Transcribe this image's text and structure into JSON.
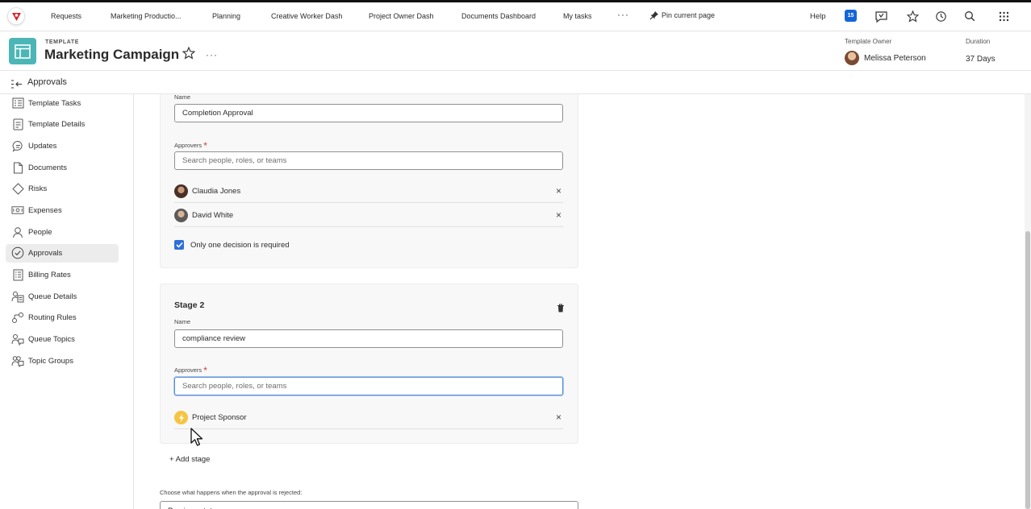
{
  "topnav": {
    "items": [
      "Requests",
      "Marketing Productio...",
      "Planning",
      "Creative Worker Dash",
      "Project Owner Dash",
      "Documents Dashboard",
      "My tasks"
    ],
    "more": "···",
    "pin_label": "Pin current page",
    "help": "Help",
    "notifications_count": "15"
  },
  "header": {
    "label": "TEMPLATE",
    "title": "Marketing Campaign",
    "more": "···",
    "owner_label": "Template Owner",
    "owner_name": "Melissa Peterson",
    "duration_label": "Duration",
    "duration_value": "37 Days",
    "accent_color": "#4cb6b6"
  },
  "subbar": {
    "title": "Approvals"
  },
  "sidebar": {
    "items": [
      {
        "label": "Template Tasks",
        "icon": "task-list-icon"
      },
      {
        "label": "Template Details",
        "icon": "details-icon"
      },
      {
        "label": "Updates",
        "icon": "chat-bubble-icon"
      },
      {
        "label": "Documents",
        "icon": "document-icon"
      },
      {
        "label": "Risks",
        "icon": "diamond-alert-icon"
      },
      {
        "label": "Expenses",
        "icon": "money-icon"
      },
      {
        "label": "People",
        "icon": "person-icon"
      },
      {
        "label": "Approvals",
        "icon": "check-circle-icon",
        "active": true
      },
      {
        "label": "Billing Rates",
        "icon": "billing-icon"
      },
      {
        "label": "Queue Details",
        "icon": "queue-icon"
      },
      {
        "label": "Routing Rules",
        "icon": "routing-icon"
      },
      {
        "label": "Queue Topics",
        "icon": "queue-topics-icon"
      },
      {
        "label": "Topic Groups",
        "icon": "topic-groups-icon"
      }
    ]
  },
  "stage1": {
    "name_label": "Name",
    "name_value": "Completion Approval",
    "approvers_label": "Approvers",
    "required_mark": "*",
    "search_placeholder": "Search people, roles, or teams",
    "approvers": [
      {
        "name": "Claudia Jones"
      },
      {
        "name": "David White"
      }
    ],
    "remove": "×",
    "one_decision_label": "Only one decision is required",
    "one_decision_checked": true
  },
  "stage2": {
    "title": "Stage 2",
    "name_label": "Name",
    "name_value": "compliance review",
    "approvers_label": "Approvers",
    "required_mark": "*",
    "search_placeholder": "Search people, roles, or teams",
    "approvers": [
      {
        "name": "Project Sponsor",
        "type": "role"
      }
    ],
    "remove": "×"
  },
  "add_stage": "+ Add stage",
  "reject": {
    "label": "Choose what happens when the approval is rejected:",
    "value": "Previous status"
  }
}
